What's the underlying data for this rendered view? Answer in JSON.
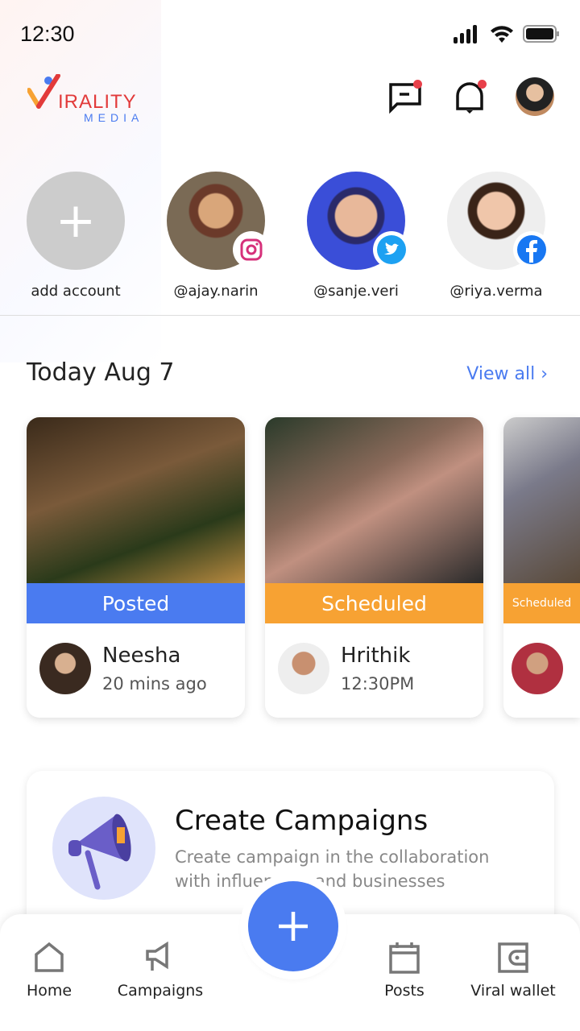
{
  "status": {
    "time": "12:30"
  },
  "brand": {
    "logo_text": "VIRALITY",
    "logo_sub": "MEDIA"
  },
  "header": {
    "icons": [
      "message-icon",
      "bell-icon",
      "profile-avatar"
    ]
  },
  "stories": [
    {
      "label": "add account",
      "type": "add"
    },
    {
      "label": "@ajay.narin",
      "network": "instagram"
    },
    {
      "label": "@sanje.veri",
      "network": "twitter"
    },
    {
      "label": "@riya.verma",
      "network": "facebook"
    }
  ],
  "today": {
    "title": "Today",
    "date": "Aug 7",
    "view_all": "View all"
  },
  "posts": [
    {
      "status": "Posted",
      "name": "Neesha",
      "sub": "20 mins ago",
      "color": "#4a7bf0"
    },
    {
      "status": "Scheduled",
      "name": "Hrithik",
      "sub": "12:30PM",
      "color": "#f7a233"
    },
    {
      "status": "Scheduled",
      "name": "",
      "sub": "",
      "color": "#f7a233"
    }
  ],
  "campaign": {
    "title": "Create Campaigns",
    "desc": "Create campaign in the collaboration with influencers and businesses"
  },
  "nav": {
    "home": "Home",
    "campaigns": "Campaigns",
    "posts": "Posts",
    "wallet": "Viral wallet"
  },
  "colors": {
    "accent": "#4a7bf0",
    "posted": "#4a7bf0",
    "scheduled": "#f7a233",
    "notification": "#e8404a"
  }
}
